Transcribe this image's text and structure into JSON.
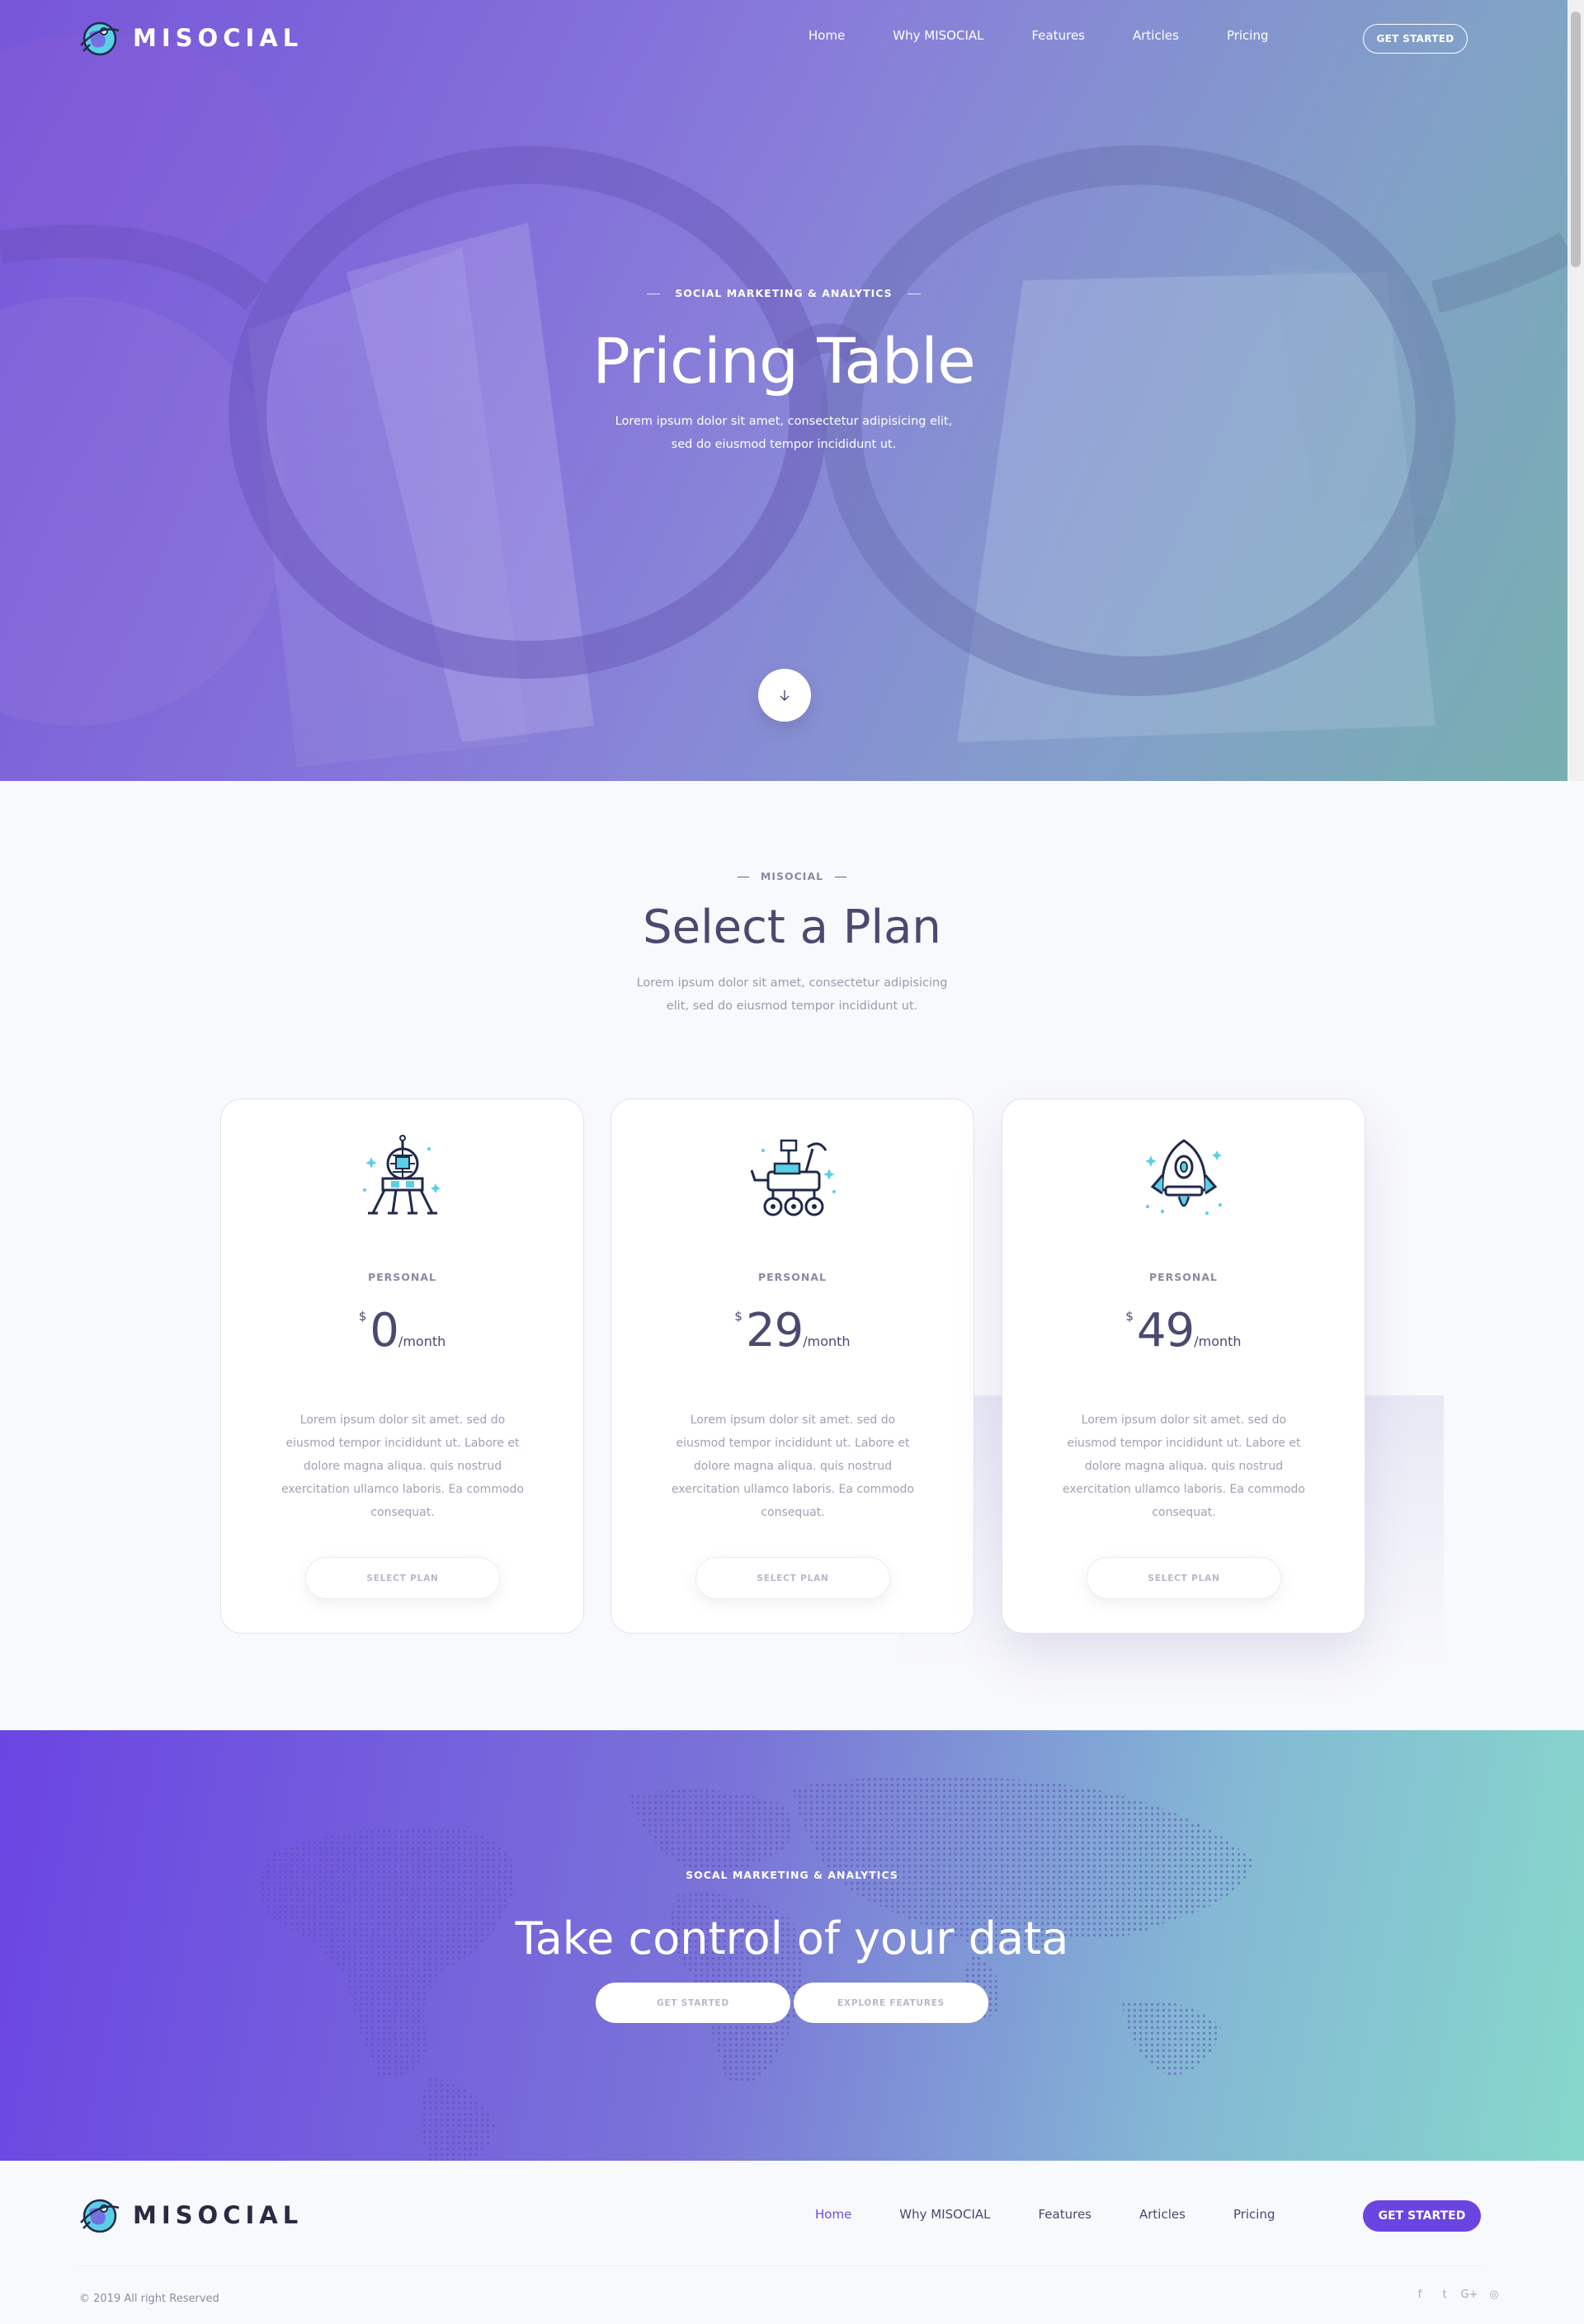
{
  "brand": {
    "name": "MISOCIAL"
  },
  "nav": {
    "items": [
      {
        "label": "Home"
      },
      {
        "label": "Why MISOCIAL"
      },
      {
        "label": "Features"
      },
      {
        "label": "Articles"
      },
      {
        "label": "Pricing"
      }
    ],
    "cta_label": "GET STARTED"
  },
  "hero": {
    "eyebrow": "SOCIAL MARKETING & ANALYTICS",
    "title": "Pricing Table",
    "subtitle": "Lorem ipsum dolor sit amet, consectetur adipisicing elit, sed do eiusmod tempor incididunt ut."
  },
  "plans": {
    "eyebrow": "MISOCIAL",
    "title": "Select a Plan",
    "subtitle": "Lorem ipsum dolor sit amet, consectetur adipisicing elit, sed do eiusmod tempor incididunt ut.",
    "cards": [
      {
        "icon": "lunar-lander-icon",
        "tier": "PERSONAL",
        "currency": "$",
        "amount": "0",
        "period": "/month",
        "description": "Lorem ipsum dolor sit amet. sed do eiusmod tempor incididunt ut. Labore et dolore magna aliqua. quis nostrud exercitation ullamco laboris. Ea commodo consequat.",
        "button": "SELECT PLAN"
      },
      {
        "icon": "rover-icon",
        "tier": "PERSONAL",
        "currency": "$",
        "amount": "29",
        "period": "/month",
        "description": "Lorem ipsum dolor sit amet. sed do eiusmod tempor incididunt ut. Labore et dolore magna aliqua. quis nostrud exercitation ullamco laboris. Ea commodo consequat.",
        "button": "SELECT PLAN"
      },
      {
        "icon": "rocket-capsule-icon",
        "tier": "PERSONAL",
        "currency": "$",
        "amount": "49",
        "period": "/month",
        "description": "Lorem ipsum dolor sit amet. sed do eiusmod tempor incididunt ut. Labore et dolore magna aliqua. quis nostrud exercitation ullamco laboris. Ea commodo consequat.",
        "button": "SELECT PLAN"
      }
    ]
  },
  "cta": {
    "eyebrow": "SOCAL MARKETING & ANALYTICS",
    "title": "Take control of your data",
    "primary_button": "GET STARTED",
    "secondary_button": "EXPLORE FEATURES"
  },
  "footer": {
    "nav": [
      {
        "label": "Home"
      },
      {
        "label": "Why MISOCIAL"
      },
      {
        "label": "Features"
      },
      {
        "label": "Articles"
      },
      {
        "label": "Pricing"
      }
    ],
    "cta_label": "GET STARTED",
    "copyright": "© 2019 All right Reserved",
    "socials": [
      {
        "icon": "facebook-icon",
        "glyph": "f"
      },
      {
        "icon": "twitter-icon",
        "glyph": "t"
      },
      {
        "icon": "google-plus-icon",
        "glyph": "G+"
      },
      {
        "icon": "instagram-icon",
        "glyph": "◎"
      }
    ]
  },
  "colors": {
    "accent": "#6a44e0",
    "heading": "#4a4970",
    "muted": "#9a9aae",
    "teal": "#86d8cb"
  }
}
